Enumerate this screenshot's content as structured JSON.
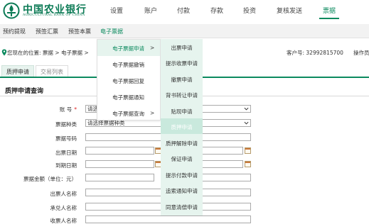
{
  "brand": {
    "name_cn": "中国农业银行",
    "name_en": "AGRICULTURAL BANK OF CHINA",
    "color": "#0b7a55"
  },
  "topnav": {
    "items": [
      "设置",
      "账户",
      "付款",
      "存款",
      "投资",
      "复核发送",
      "票据"
    ],
    "active_index": 6
  },
  "subnav": {
    "items": [
      "预约提现",
      "预签汇票",
      "预签本票",
      "电子票据"
    ],
    "active_index": 3
  },
  "location": {
    "label": "您现在的位置: 票据 > 电子票据 >",
    "customer": "客户号: 32992815700",
    "operator": "操作员"
  },
  "tabs": [
    "质押申请",
    "交易列表"
  ],
  "section_title": "质押申请查询",
  "form": {
    "account_label": "账 号",
    "account_required": "*",
    "account_value": "请选",
    "bill_type_label": "票据种类",
    "bill_type_value": "请选择票据种类",
    "bill_number_label": "票据号码",
    "issue_date_label": "出票日期",
    "due_date_label": "到期日期",
    "amount_label": "票据金额（单位：元）",
    "drawer_label": "出票人名称",
    "acceptor_label": "承兑人名称",
    "payee_label": "收票人名称"
  },
  "menu_level1": {
    "items": [
      "电子票据申请",
      "电子票据撤销",
      "电子票据回复",
      "电子票据通知",
      "电子票据查询"
    ],
    "chevron": ">",
    "highlight_index": 0,
    "submenu_indices": [
      0,
      4
    ]
  },
  "menu_level2": {
    "items": [
      "出票申请",
      "提示收票申请",
      "撤票申请",
      "背书转让申请",
      "贴现申请",
      "质押申请",
      "质押解除申请",
      "保证申请",
      "提示付款申请",
      "追索通知申请",
      "同意清偿申请"
    ],
    "highlight_index": 5
  },
  "colors": {
    "accent": "#0b8a5e",
    "menu_bg": "#e6f4ee",
    "required": "#d22222"
  },
  "icons": {
    "location": "location-pin-icon",
    "select_arrow": "chevron-down-icon",
    "calendar": "calendar-icon"
  }
}
